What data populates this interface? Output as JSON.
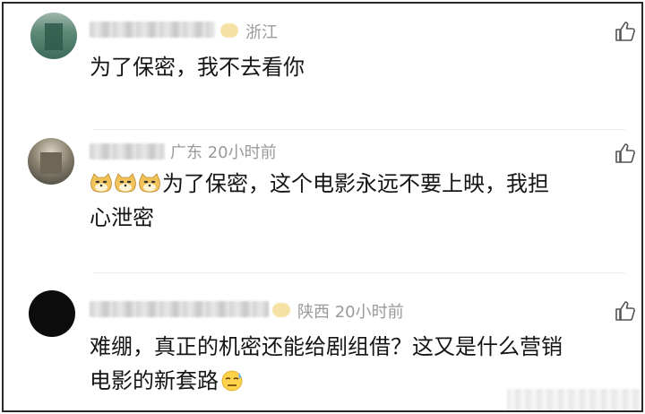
{
  "comments": [
    {
      "location": "浙江",
      "text": "为了保密，我不去看你"
    },
    {
      "meta": "广东 20小时前",
      "emoji": [
        "doge-emoji",
        "doge-emoji",
        "doge-emoji"
      ],
      "text_line1": "为了保密，这个电影永远不要上映，我担",
      "text_line2": "心泄密"
    },
    {
      "meta": "陕西 20小时前",
      "text_line1": "难绷，真正的机密还能给剧组借？这又是什么营销",
      "text_line2": "电影的新套路",
      "trailing_emoji": "sweat-emoji"
    }
  ],
  "icons": {
    "like": "thumbs-up-icon"
  },
  "colors": {
    "text": "#151515",
    "meta": "#9a9a9a",
    "frame": "#2a2a2a"
  }
}
